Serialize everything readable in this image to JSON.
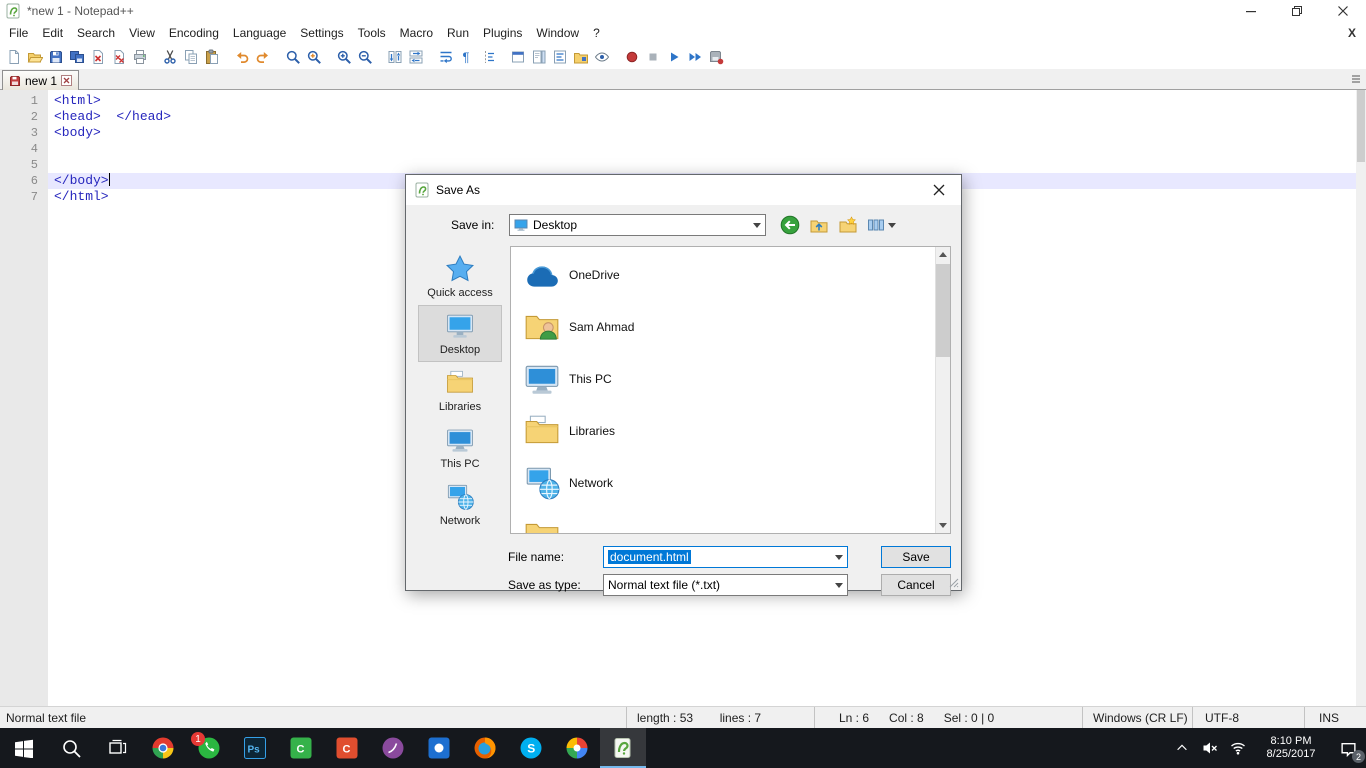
{
  "window": {
    "title": "*new 1 - Notepad++"
  },
  "menu_bar": {
    "items": [
      "File",
      "Edit",
      "Search",
      "View",
      "Encoding",
      "Language",
      "Settings",
      "Tools",
      "Macro",
      "Run",
      "Plugins",
      "Window",
      "?"
    ],
    "close_label": "X"
  },
  "toolbar": {
    "icons": [
      "new-file",
      "open-file",
      "save",
      "save-all",
      "close-file",
      "close-all",
      "print",
      "cut",
      "copy",
      "paste",
      "undo",
      "redo",
      "find",
      "replace",
      "zoom-in",
      "zoom-out",
      "sync-vertical-scroll",
      "sync-horizontal-scroll",
      "word-wrap",
      "view-all-characters",
      "indent-guide",
      "user-defined-dialog",
      "document-map",
      "function-list",
      "folder-as-workspace",
      "monitoring",
      "record-macro",
      "stop-recording",
      "playback-macro",
      "run-macro-multiple",
      "save-recorded-macro"
    ],
    "separators_after": [
      6,
      9,
      11,
      13,
      15,
      17,
      20,
      25
    ]
  },
  "tab_bar": {
    "tabs": [
      {
        "label": "new 1",
        "unsaved": true,
        "active": true
      }
    ]
  },
  "editor": {
    "current_line": 6,
    "lines": [
      "<html>",
      "<head>  </head>",
      "<body>",
      "",
      "",
      "</body>",
      "</html>"
    ]
  },
  "save_dialog": {
    "title": "Save As",
    "save_in_label": "Save in:",
    "save_in_value": "Desktop",
    "nav_icons": [
      "back-icon",
      "up-one-level-icon",
      "create-new-folder-icon",
      "view-menu-icon"
    ],
    "sidebar_items": [
      {
        "label": "Quick access",
        "icon": "quick-access",
        "selected": false
      },
      {
        "label": "Desktop",
        "icon": "desktop",
        "selected": true
      },
      {
        "label": "Libraries",
        "icon": "libraries",
        "selected": false
      },
      {
        "label": "This PC",
        "icon": "this-pc",
        "selected": false
      },
      {
        "label": "Network",
        "icon": "network",
        "selected": false
      }
    ],
    "file_list": [
      {
        "name": "OneDrive",
        "icon": "onedrive"
      },
      {
        "name": "Sam Ahmad",
        "icon": "user-folder"
      },
      {
        "name": "This PC",
        "icon": "this-pc"
      },
      {
        "name": "Libraries",
        "icon": "libraries"
      },
      {
        "name": "Network",
        "icon": "network"
      },
      {
        "name": "",
        "icon": "folder"
      }
    ],
    "file_name_label": "File name:",
    "file_name_value": "document.html",
    "save_as_type_label": "Save as type:",
    "save_as_type_value": "Normal text file (*.txt)",
    "save_button_label": "Save",
    "cancel_button_label": "Cancel"
  },
  "status_bar": {
    "doc_type": "Normal text file",
    "length_info": "length : 53        lines : 7",
    "cursor_info": "Ln : 6      Col : 8      Sel : 0 | 0",
    "eol_format": "Windows (CR LF)",
    "encoding": "UTF-8",
    "typing_mode": "INS"
  },
  "taskbar": {
    "apps": [
      {
        "name": "start"
      },
      {
        "name": "search"
      },
      {
        "name": "task-view"
      },
      {
        "name": "chrome"
      },
      {
        "name": "whatsapp",
        "badge": "1"
      },
      {
        "name": "photoshop",
        "label": "Ps"
      },
      {
        "name": "camtasia",
        "label": "C"
      },
      {
        "name": "c-app",
        "label": "C"
      },
      {
        "name": "purple-app"
      },
      {
        "name": "blue-app"
      },
      {
        "name": "firefox"
      },
      {
        "name": "skype",
        "label": "S"
      },
      {
        "name": "colorful-app"
      },
      {
        "name": "notepad-plus-plus",
        "active": true
      }
    ],
    "tray": {
      "time": "8:10 PM",
      "date": "8/25/2017",
      "notification_badge": "2"
    }
  },
  "colors": {
    "accent": "#0078d7",
    "selection": "#0078d7",
    "taskbar": "#15181d",
    "current_line": "#e8e8ff"
  }
}
